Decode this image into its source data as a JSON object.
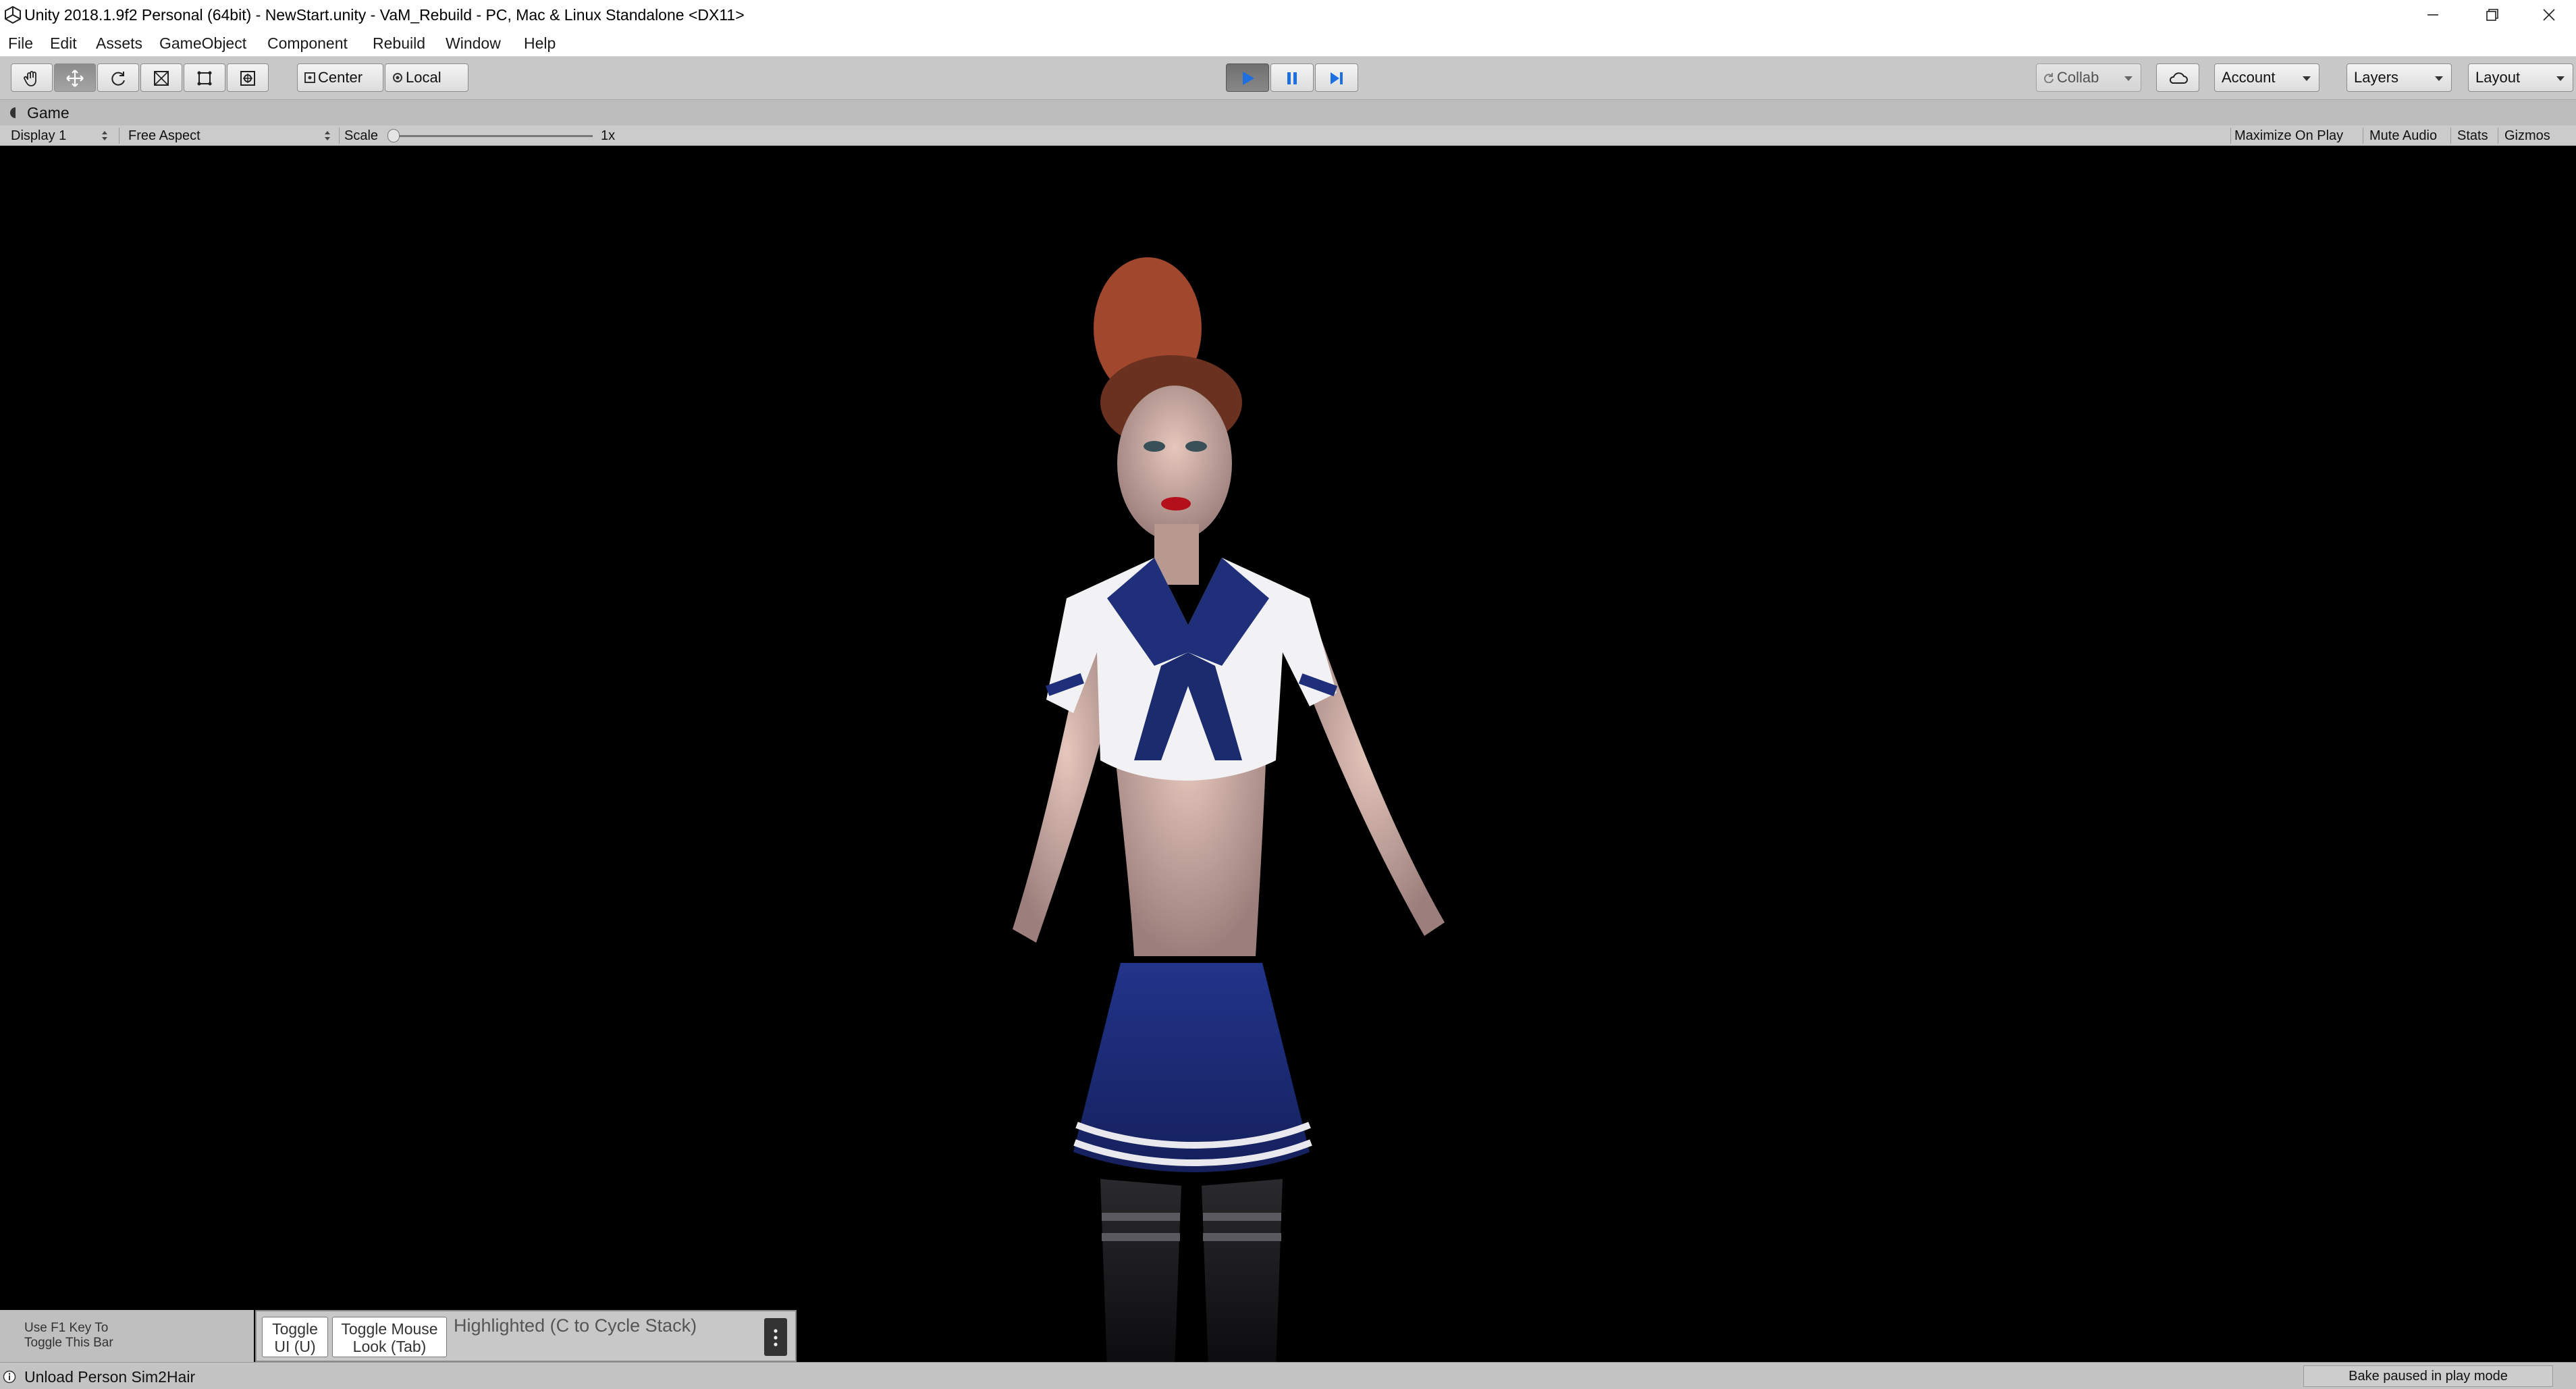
{
  "window": {
    "title": "Unity 2018.1.9f2 Personal (64bit) - NewStart.unity - VaM_Rebuild - PC, Mac & Linux Standalone <DX11>",
    "app_icon": "unity-logo-icon",
    "controls": [
      "minimize-icon",
      "maximize-icon",
      "close-icon"
    ]
  },
  "menu": {
    "items": [
      "File",
      "Edit",
      "Assets",
      "GameObject",
      "Component",
      "Rebuild",
      "Window",
      "Help"
    ]
  },
  "toolbar": {
    "tools": [
      "hand-icon",
      "move-icon",
      "rotate-icon",
      "scale-icon",
      "rect-icon",
      "transform-icon"
    ],
    "active_tool": "move-icon",
    "pivot_mode": "Center",
    "pivot_rotation": "Local",
    "playback": {
      "play": "play-icon",
      "pause": "pause-icon",
      "step": "step-icon",
      "playing": true
    },
    "collab_label": "Collab",
    "cloud_icon": "cloud-icon",
    "account_label": "Account",
    "layers_label": "Layers",
    "layout_label": "Layout"
  },
  "game_panel": {
    "tab_label": "Game",
    "display": "Display 1",
    "aspect": "Free Aspect",
    "scale_label": "Scale",
    "scale_value": "1x",
    "toggles": [
      "Maximize On Play",
      "Mute Audio",
      "Stats",
      "Gizmos"
    ]
  },
  "overlay": {
    "hint_line1": "Use F1 Key To",
    "hint_line2": "Toggle This Bar",
    "toggle_ui_line1": "Toggle",
    "toggle_ui_line2": "UI (U)",
    "toggle_look_line1": "Toggle Mouse",
    "toggle_look_line2": "Look (Tab)",
    "highlighted": "Highlighted (C to Cycle Stack)",
    "more_icon": "more-vertical-icon"
  },
  "status": {
    "icon": "info-icon",
    "message": "Unload Person Sim2Hair",
    "bake": "Bake paused in play mode"
  },
  "colors": {
    "toolbar_bg": "#c8c8c8",
    "play_active": "#1e6fe0",
    "uniform_navy": "#1f2f7a",
    "viewport_bg": "#000000"
  }
}
